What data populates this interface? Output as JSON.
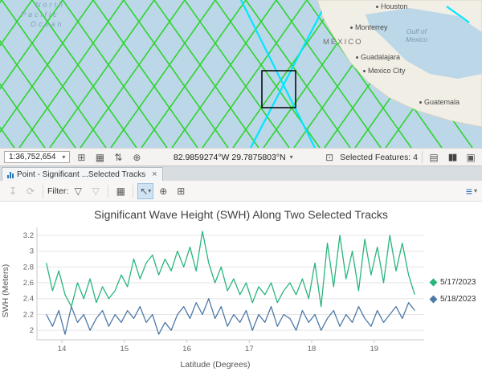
{
  "colors": {
    "water": "#bcd7e8",
    "land": "#f1eee5",
    "track_green": "#2fd42f",
    "track_cyan": "#00e6ff",
    "selection_box": "#000000"
  },
  "icons": {
    "caret_down": "▾",
    "full_extent": "⊞",
    "grid": "▦",
    "swap": "⇅",
    "zoom": "⊕",
    "select_box": "⊡",
    "table_view": "▤",
    "pause": "▮▮",
    "lock": "▣",
    "export": "↧",
    "refresh": "⟳",
    "funnel": "▽",
    "table": "▦",
    "pointer": "↖",
    "zoom_in": "⊕",
    "fixed_zoom": "⊞",
    "legend_toggle": "≡",
    "close": "×"
  },
  "map": {
    "ocean": [
      "North",
      "Pacific",
      "Ocean"
    ],
    "gulf": [
      "Gulf of",
      "Mexico"
    ],
    "cities": {
      "houston": "Houston",
      "monterrey": "Monterrey",
      "mexico": "MÉXICO",
      "guadalajara": "Guadalajara",
      "mexico_city": "Mexico City",
      "guatemala": "Guatemala"
    }
  },
  "statusbar": {
    "scale": "1:36,752,654",
    "coordinates": "82.9859274°W 29.7875803°N",
    "selected_features": "Selected Features: 4"
  },
  "tabbar": {
    "tab_title": "Point - Significant ...Selected Tracks"
  },
  "toolbar": {
    "filter_label": "Filter:"
  },
  "chart_data": {
    "type": "line",
    "title": "Significant Wave Height (SWH) Along Two Selected Tracks",
    "xlabel": "Latitude (Degrees)",
    "ylabel": "SWH (Meters)",
    "xlim": [
      13.6,
      19.8
    ],
    "ylim": [
      1.88,
      3.3
    ],
    "x_ticks": [
      14,
      15,
      16,
      17,
      18,
      19
    ],
    "y_ticks": [
      2,
      2.2,
      2.4,
      2.6,
      2.8,
      3,
      3.2
    ],
    "grid": "horizontal",
    "legend_position": "right",
    "series": [
      {
        "name": "5/17/2023",
        "color": "#2ab57d",
        "points": [
          [
            13.75,
            2.85
          ],
          [
            13.85,
            2.5
          ],
          [
            13.95,
            2.75
          ],
          [
            14.05,
            2.45
          ],
          [
            14.15,
            2.3
          ],
          [
            14.25,
            2.6
          ],
          [
            14.35,
            2.4
          ],
          [
            14.45,
            2.65
          ],
          [
            14.55,
            2.35
          ],
          [
            14.65,
            2.55
          ],
          [
            14.75,
            2.4
          ],
          [
            14.85,
            2.5
          ],
          [
            14.95,
            2.7
          ],
          [
            15.05,
            2.55
          ],
          [
            15.15,
            2.9
          ],
          [
            15.25,
            2.65
          ],
          [
            15.35,
            2.85
          ],
          [
            15.45,
            2.95
          ],
          [
            15.55,
            2.7
          ],
          [
            15.65,
            2.9
          ],
          [
            15.75,
            2.75
          ],
          [
            15.85,
            3.0
          ],
          [
            15.95,
            2.8
          ],
          [
            16.05,
            3.05
          ],
          [
            16.15,
            2.75
          ],
          [
            16.25,
            3.25
          ],
          [
            16.35,
            2.85
          ],
          [
            16.45,
            2.6
          ],
          [
            16.55,
            2.8
          ],
          [
            16.65,
            2.5
          ],
          [
            16.75,
            2.65
          ],
          [
            16.85,
            2.45
          ],
          [
            16.95,
            2.6
          ],
          [
            17.05,
            2.35
          ],
          [
            17.15,
            2.55
          ],
          [
            17.25,
            2.45
          ],
          [
            17.35,
            2.6
          ],
          [
            17.45,
            2.35
          ],
          [
            17.55,
            2.5
          ],
          [
            17.65,
            2.6
          ],
          [
            17.75,
            2.45
          ],
          [
            17.85,
            2.65
          ],
          [
            17.95,
            2.4
          ],
          [
            18.05,
            2.85
          ],
          [
            18.15,
            2.3
          ],
          [
            18.25,
            3.1
          ],
          [
            18.35,
            2.55
          ],
          [
            18.45,
            3.2
          ],
          [
            18.55,
            2.65
          ],
          [
            18.65,
            3.0
          ],
          [
            18.75,
            2.5
          ],
          [
            18.85,
            3.15
          ],
          [
            18.95,
            2.7
          ],
          [
            19.05,
            3.05
          ],
          [
            19.15,
            2.6
          ],
          [
            19.25,
            3.2
          ],
          [
            19.35,
            2.75
          ],
          [
            19.45,
            3.1
          ],
          [
            19.55,
            2.7
          ],
          [
            19.65,
            2.45
          ]
        ]
      },
      {
        "name": "5/18/2023",
        "color": "#4e79a7",
        "points": [
          [
            13.75,
            2.2
          ],
          [
            13.85,
            2.05
          ],
          [
            13.95,
            2.25
          ],
          [
            14.05,
            1.95
          ],
          [
            14.15,
            2.3
          ],
          [
            14.25,
            2.1
          ],
          [
            14.35,
            2.2
          ],
          [
            14.45,
            2.0
          ],
          [
            14.55,
            2.15
          ],
          [
            14.65,
            2.25
          ],
          [
            14.75,
            2.05
          ],
          [
            14.85,
            2.2
          ],
          [
            14.95,
            2.1
          ],
          [
            15.05,
            2.25
          ],
          [
            15.15,
            2.15
          ],
          [
            15.25,
            2.3
          ],
          [
            15.35,
            2.1
          ],
          [
            15.45,
            2.2
          ],
          [
            15.55,
            1.95
          ],
          [
            15.65,
            2.1
          ],
          [
            15.75,
            2.0
          ],
          [
            15.85,
            2.2
          ],
          [
            15.95,
            2.3
          ],
          [
            16.05,
            2.15
          ],
          [
            16.15,
            2.35
          ],
          [
            16.25,
            2.2
          ],
          [
            16.35,
            2.4
          ],
          [
            16.45,
            2.15
          ],
          [
            16.55,
            2.3
          ],
          [
            16.65,
            2.05
          ],
          [
            16.75,
            2.2
          ],
          [
            16.85,
            2.1
          ],
          [
            16.95,
            2.25
          ],
          [
            17.05,
            2.0
          ],
          [
            17.15,
            2.2
          ],
          [
            17.25,
            2.1
          ],
          [
            17.35,
            2.3
          ],
          [
            17.45,
            2.05
          ],
          [
            17.55,
            2.2
          ],
          [
            17.65,
            2.15
          ],
          [
            17.75,
            2.0
          ],
          [
            17.85,
            2.25
          ],
          [
            17.95,
            2.1
          ],
          [
            18.05,
            2.2
          ],
          [
            18.15,
            2.0
          ],
          [
            18.25,
            2.15
          ],
          [
            18.35,
            2.25
          ],
          [
            18.45,
            2.05
          ],
          [
            18.55,
            2.2
          ],
          [
            18.65,
            2.1
          ],
          [
            18.75,
            2.3
          ],
          [
            18.85,
            2.15
          ],
          [
            18.95,
            2.05
          ],
          [
            19.05,
            2.25
          ],
          [
            19.15,
            2.1
          ],
          [
            19.25,
            2.2
          ],
          [
            19.35,
            2.3
          ],
          [
            19.45,
            2.15
          ],
          [
            19.55,
            2.35
          ],
          [
            19.65,
            2.25
          ]
        ]
      }
    ]
  }
}
